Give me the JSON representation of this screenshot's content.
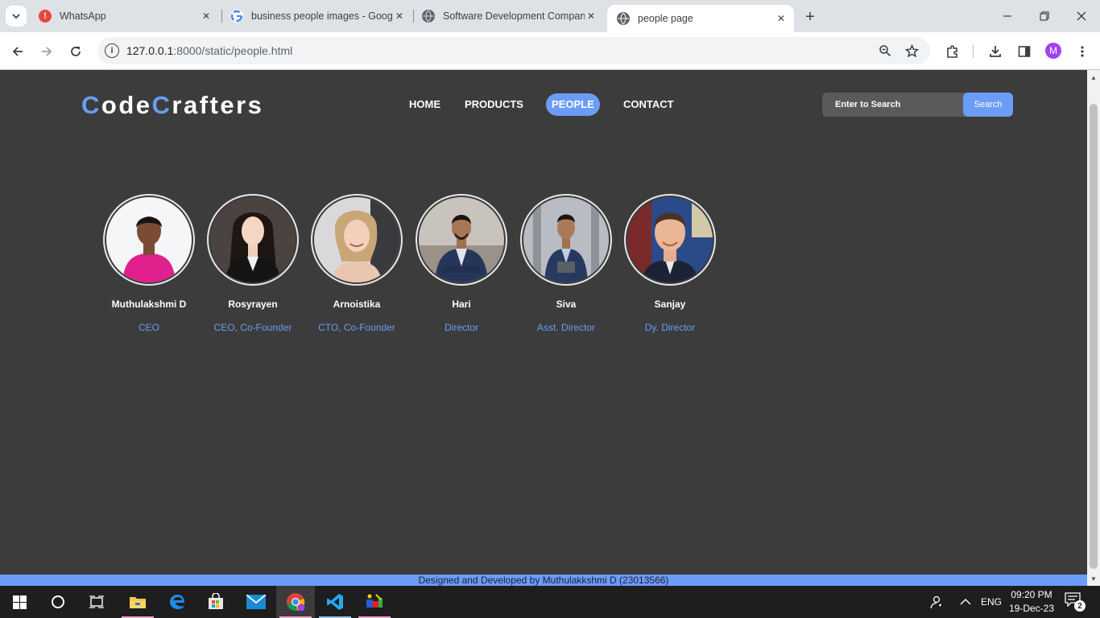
{
  "browser": {
    "tabs": [
      {
        "label": "WhatsApp",
        "icon": "whatsapp-alert-icon"
      },
      {
        "label": "business people images - Goog",
        "icon": "google-g-icon"
      },
      {
        "label": "Software Development Compan",
        "icon": "globe-icon"
      },
      {
        "label": "people page",
        "icon": "globe-icon",
        "active": true
      }
    ],
    "url_host": "127.0.0.1",
    "url_path": ":8000/static/people.html",
    "profile_initial": "M"
  },
  "site": {
    "logo": {
      "c1": "C",
      "part1": "ode",
      "c2": "C",
      "part2": "rafters"
    },
    "nav": [
      "HOME",
      "PRODUCTS",
      "PEOPLE",
      "CONTACT"
    ],
    "active_nav": "PEOPLE",
    "search_placeholder": "Enter to Search",
    "search_button": "Search",
    "people": [
      {
        "name": "Muthulakshmi D",
        "role": "CEO"
      },
      {
        "name": "Rosyrayen",
        "role": "CEO, Co-Founder"
      },
      {
        "name": "Arnoistika",
        "role": "CTO, Co-Founder"
      },
      {
        "name": "Hari",
        "role": "Director"
      },
      {
        "name": "Siva",
        "role": "Asst. Director"
      },
      {
        "name": "Sanjay",
        "role": "Dy. Director"
      }
    ],
    "footer": "Designed and Developed by Muthulakkshmi D (23013566)"
  },
  "taskbar": {
    "language": "ENG",
    "time": "09:20 PM",
    "date": "19-Dec-23",
    "notification_count": "2"
  },
  "colors": {
    "accent": "#6b9cf7",
    "page_bg": "#3c3c3c"
  }
}
